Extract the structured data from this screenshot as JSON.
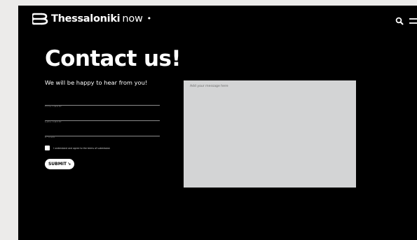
{
  "brand": {
    "name_bold": "Thessaloniki",
    "name_light": "now",
    "dot": "•"
  },
  "header": {
    "icons": [
      "search-icon",
      "menu-icon"
    ]
  },
  "contact": {
    "title": "Contact us!",
    "subtitle": "We will be happy to hear from you!",
    "fields": {
      "first_name_placeholder": "First name",
      "last_name_placeholder": "Last name",
      "email_placeholder": "E-mail"
    },
    "consent_label": "I understand and agree to the terms of submission",
    "submit_label": "SUBMIT",
    "submit_arrow": "↘",
    "message_placeholder": "Add your message here"
  },
  "colors": {
    "background": "#000000",
    "page_margin": "#ecebea",
    "message_box": "#d3d4d5",
    "text": "#ffffff"
  }
}
